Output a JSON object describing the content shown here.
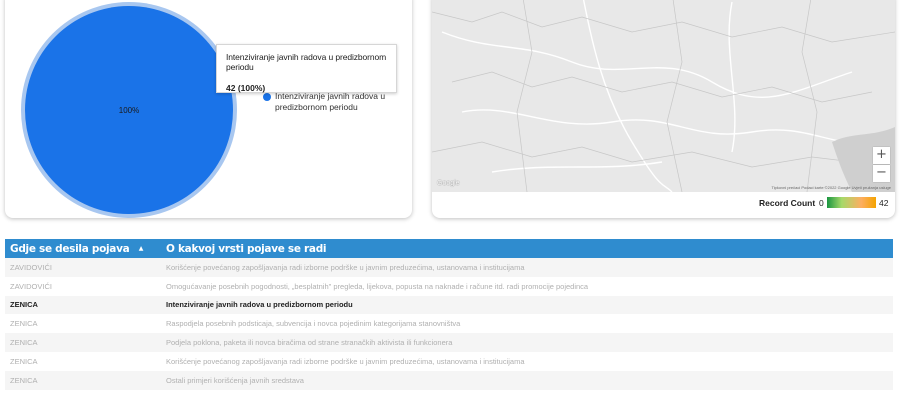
{
  "pie_chart": {
    "slice_label": "100%",
    "slice_color": "#1a73e8",
    "ring_color": "#a8c7f0",
    "tooltip": {
      "title": "Intenziviranje javnih radova u predizbornom periodu",
      "value": "42 (100%)"
    },
    "legend": [
      {
        "label": "Intenziviranje javnih radova u predizbornom periodu",
        "color": "#1a73e8"
      }
    ]
  },
  "chart_data": {
    "type": "pie",
    "categories": [
      "Intenziviranje javnih radova u predizbornom periodu"
    ],
    "values": [
      42
    ],
    "percent": [
      100
    ]
  },
  "map": {
    "zoom_in": "+",
    "zoom_out": "−",
    "logo": "Google",
    "credit": "Tipkovni prečaci  Podaci karte ©2022 Google  Uvjeti pružanja usluge",
    "legend_title": "Record Count",
    "legend_min": "0",
    "legend_max": "42"
  },
  "table": {
    "headers": [
      "Gdje se desila pojava",
      "O kakvoj vrsti pojave se radi"
    ],
    "sort_icon": "▲",
    "rows": [
      {
        "place": "ZAVIDOVIĆI",
        "type": "Korišćenje povećanog zapošljavanja radi izborne podrške u javnim preduzećima, ustanovama i institucijama"
      },
      {
        "place": "ZAVIDOVIĆI",
        "type": "Omogućavanje posebnih pogodnosti, „besplatnih\" pregleda, lijekova, popusta na naknade i račune itd. radi promocije pojedinca"
      },
      {
        "place": "ZENICA",
        "type": "Intenziviranje javnih radova u predizbornom periodu",
        "active": true
      },
      {
        "place": "ZENICA",
        "type": "Raspodjela posebnih podsticaja, subvencija i novca pojedinim kategorijama stanovništva"
      },
      {
        "place": "ZENICA",
        "type": "Podjela poklona, paketa ili novca biračima od strane stranačkih aktivista ili funkcionera"
      },
      {
        "place": "ZENICA",
        "type": "Korišćenje povećanog zapošljavanja radi izborne podrške u javnim preduzećima, ustanovama i institucijama"
      },
      {
        "place": "ZENICA",
        "type": "Ostali primjeri korišćenja javnih sredstava"
      }
    ]
  }
}
